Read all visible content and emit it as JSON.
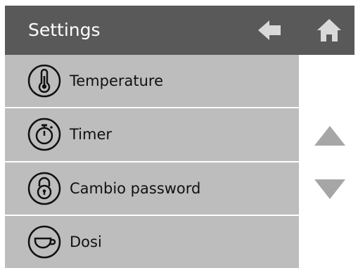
{
  "header": {
    "title": "Settings",
    "back_icon": "arrow-left-icon",
    "home_icon": "home-icon"
  },
  "menu": {
    "items": [
      {
        "label": "Temperature",
        "icon": "thermometer-icon"
      },
      {
        "label": "Timer",
        "icon": "stopwatch-icon"
      },
      {
        "label": "Cambio password",
        "icon": "padlock-icon"
      },
      {
        "label": "Dosi",
        "icon": "cup-icon"
      }
    ]
  },
  "scroll": {
    "up_icon": "scroll-up-icon",
    "down_icon": "scroll-down-icon"
  },
  "colors": {
    "header_bg": "#595959",
    "item_bg": "#bdbdbd",
    "arrow": "#a6a6a6",
    "text": "#111111"
  }
}
